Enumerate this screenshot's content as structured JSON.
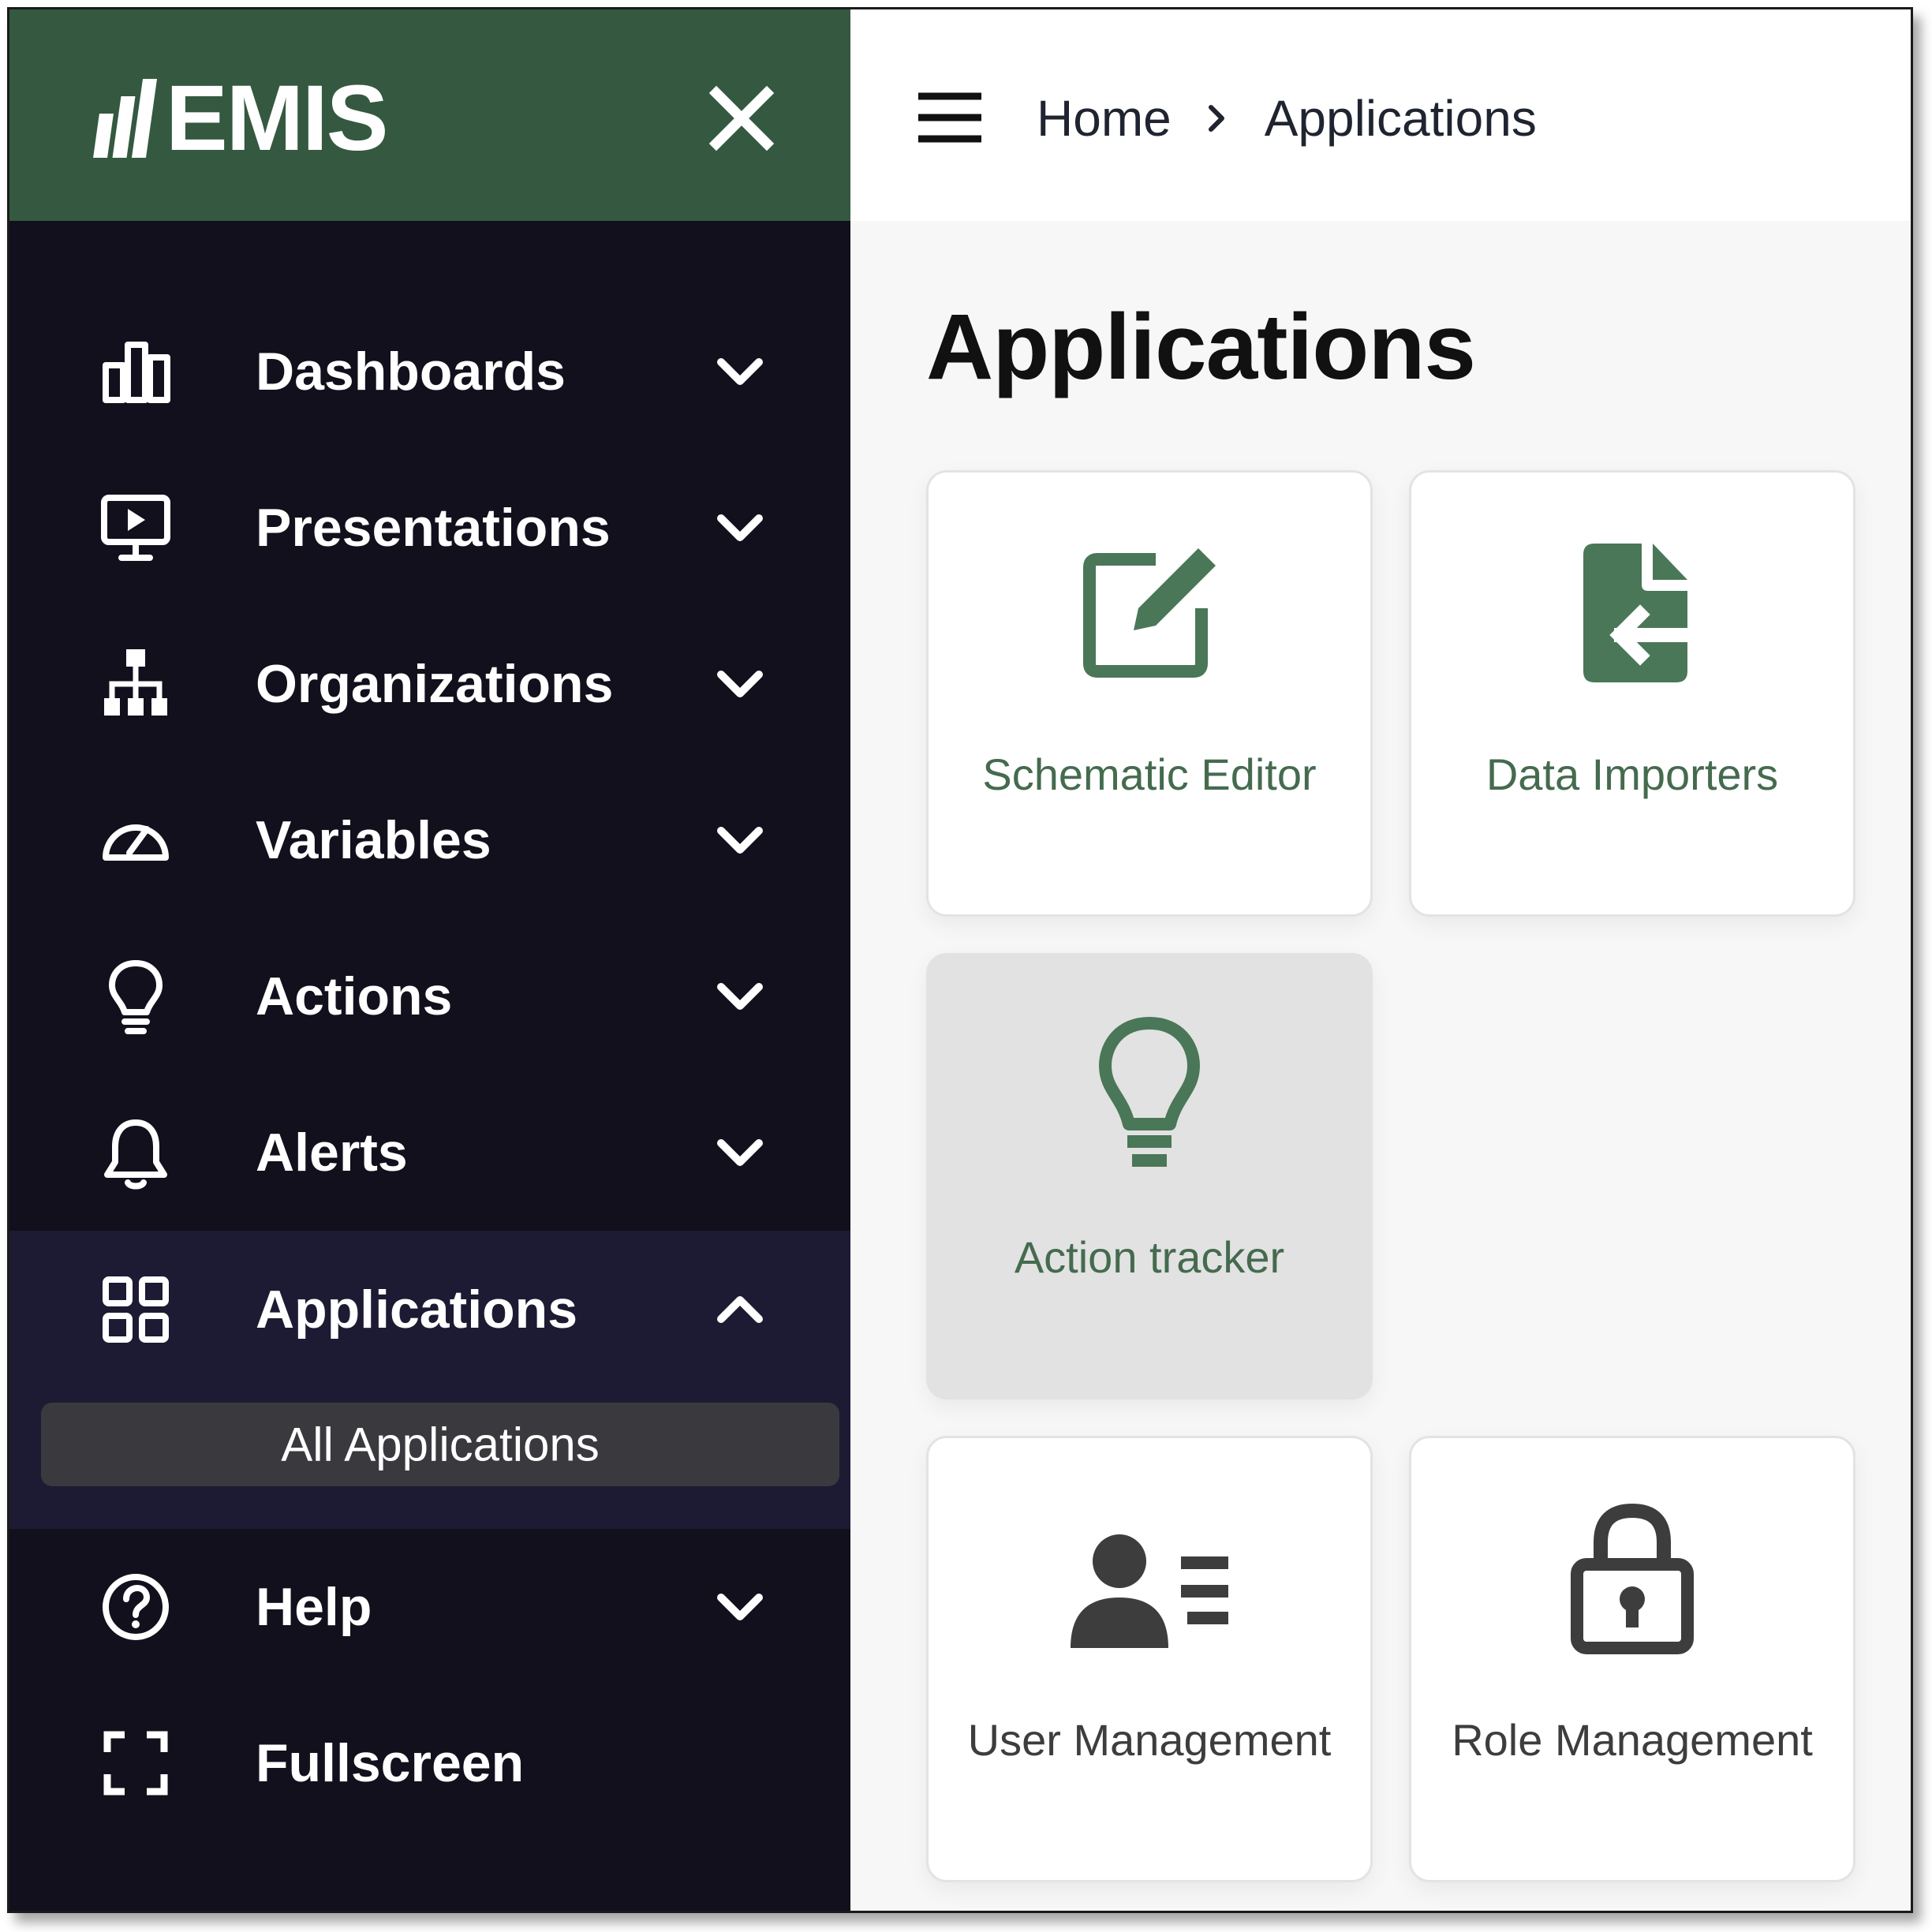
{
  "brand": {
    "logo_text": "EMIS",
    "header_color": "#345940",
    "accent_color": "#4a7757"
  },
  "sidebar": {
    "close_icon": "close-icon",
    "items": [
      {
        "label": "Dashboards",
        "icon": "bar-chart-icon",
        "expanded": false
      },
      {
        "label": "Presentations",
        "icon": "presentation-monitor-icon",
        "expanded": false
      },
      {
        "label": "Organizations",
        "icon": "sitemap-icon",
        "expanded": false
      },
      {
        "label": "Variables",
        "icon": "gauge-icon",
        "expanded": false
      },
      {
        "label": "Actions",
        "icon": "lightbulb-icon",
        "expanded": false
      },
      {
        "label": "Alerts",
        "icon": "bell-icon",
        "expanded": false
      },
      {
        "label": "Applications",
        "icon": "grid-icon",
        "expanded": true,
        "sub_items": [
          {
            "label": "All Applications",
            "active": true
          }
        ]
      },
      {
        "label": "Help",
        "icon": "help-circle-icon",
        "expanded": false
      },
      {
        "label": "Fullscreen",
        "icon": "fullscreen-icon"
      }
    ]
  },
  "topbar": {
    "menu_icon": "hamburger-menu-icon",
    "breadcrumb": [
      "Home",
      "Applications"
    ]
  },
  "main": {
    "title": "Applications",
    "tiles": [
      {
        "label": "Schematic Editor",
        "icon": "edit-square-icon",
        "color": "#4a7757"
      },
      {
        "label": "Data Importers",
        "icon": "file-import-icon",
        "color": "#4a7757"
      },
      {
        "label": "Action tracker",
        "icon": "lightbulb-icon",
        "color": "#4a7757",
        "hovered": true
      },
      {
        "label": "User Management",
        "icon": "user-list-icon",
        "color": "#3d3d3d"
      },
      {
        "label": "Role Management",
        "icon": "padlock-icon",
        "color": "#3d3d3d"
      }
    ]
  }
}
